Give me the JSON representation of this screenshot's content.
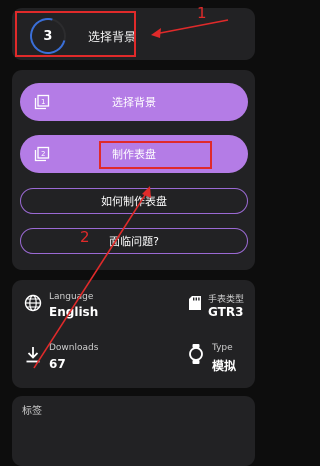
{
  "step": {
    "number": "3",
    "title": "选择背景"
  },
  "actions": {
    "select_background": "选择背景",
    "make_watchface": "制作表盘",
    "how_to_make": "如何制作表盘",
    "problems": "面临问题?"
  },
  "info": {
    "language": {
      "label": "Language",
      "value": "English",
      "icon": "globe-icon"
    },
    "watch_type": {
      "label": "手表类型",
      "value": "GTR3",
      "icon": "sd-card-icon"
    },
    "downloads": {
      "label": "Downloads",
      "value": "67",
      "icon": "download-icon"
    },
    "type": {
      "label": "Type",
      "value": "模拟",
      "icon": "watch-icon"
    }
  },
  "tags": {
    "label": "标签"
  },
  "annotations": {
    "one": "1",
    "two": "2",
    "color": "#e02a2a"
  },
  "colors": {
    "accent": "#b47ce6",
    "card": "#222224",
    "background": "#0d0d0d"
  }
}
